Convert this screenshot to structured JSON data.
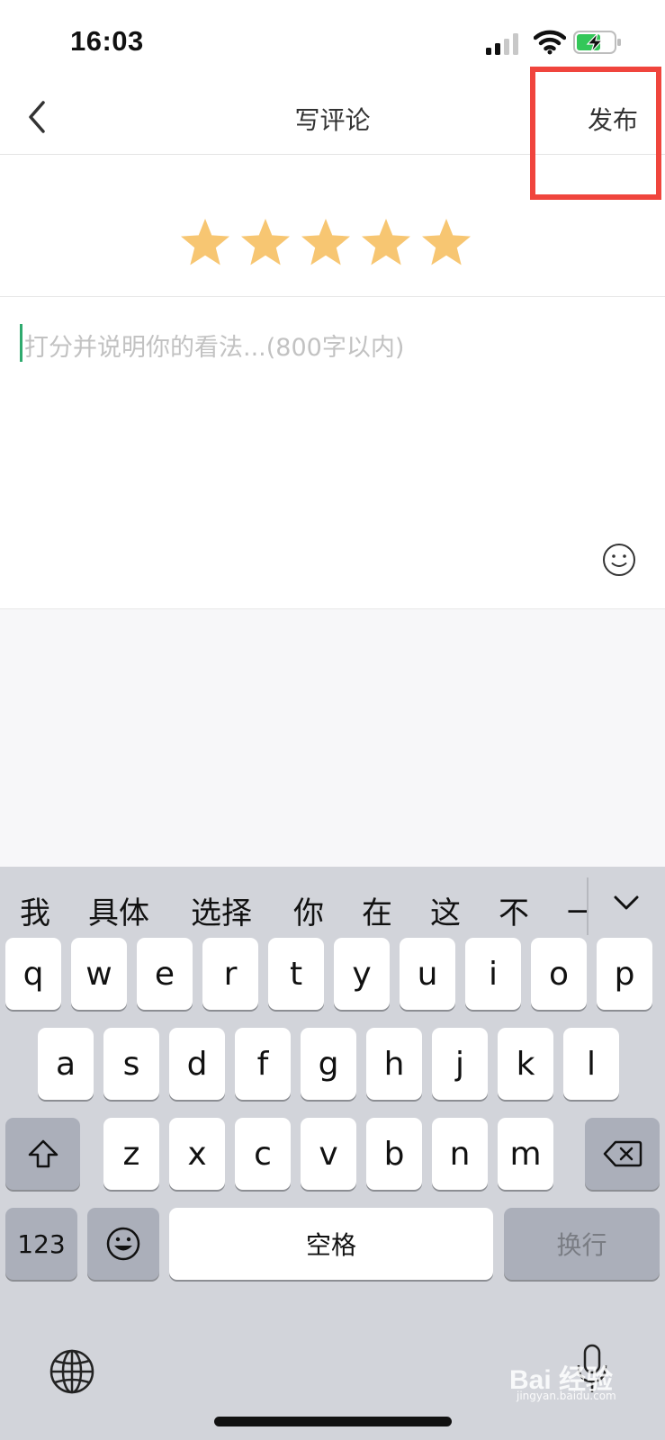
{
  "status_bar": {
    "time": "16:03"
  },
  "nav": {
    "title": "写评论",
    "publish_label": "发布"
  },
  "rating": {
    "value": 5,
    "max": 5,
    "star_color": "#f7c672"
  },
  "editor": {
    "placeholder": "打分并说明你的看法...(800字以内)",
    "value": ""
  },
  "keyboard": {
    "candidates": [
      "我",
      "具体",
      "选择",
      "你",
      "在",
      "这",
      "不",
      "一"
    ],
    "row1": [
      "q",
      "w",
      "e",
      "r",
      "t",
      "y",
      "u",
      "i",
      "o",
      "p"
    ],
    "row2": [
      "a",
      "s",
      "d",
      "f",
      "g",
      "h",
      "j",
      "k",
      "l"
    ],
    "row3": [
      "z",
      "x",
      "c",
      "v",
      "b",
      "n",
      "m"
    ],
    "numbers_label": "123",
    "space_label": "空格",
    "return_label": "换行"
  },
  "watermark": {
    "brand": "Bai 经验",
    "url": "jingyan.baidu.com"
  },
  "colors": {
    "accent_cursor": "#2faa6e",
    "highlight": "#f0453d",
    "keyboard_bg": "#d2d4da"
  }
}
